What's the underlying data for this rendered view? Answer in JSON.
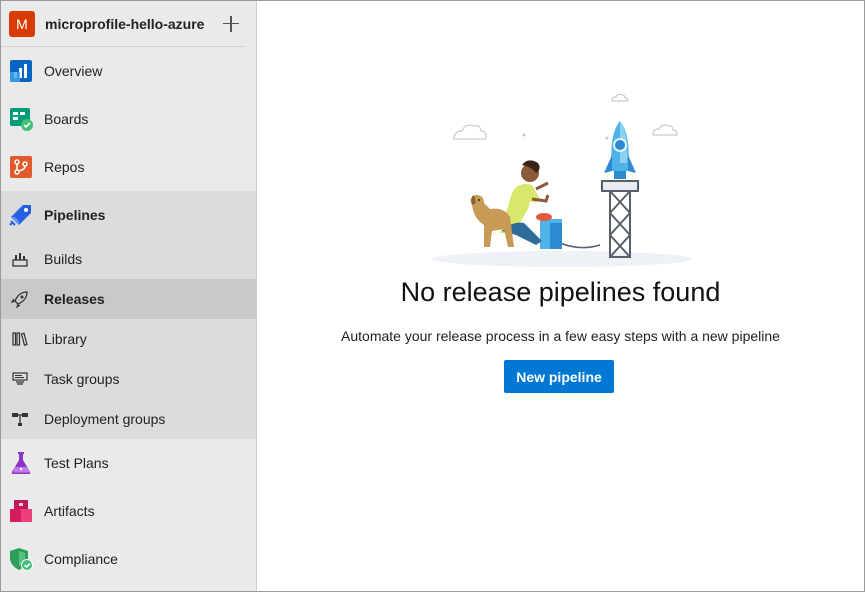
{
  "project": {
    "avatar_letter": "M",
    "name": "microprofile-hello-azure",
    "avatar_color": "#da3b01"
  },
  "nav": {
    "overview": "Overview",
    "boards": "Boards",
    "repos": "Repos",
    "pipelines": "Pipelines",
    "pipelines_sub": {
      "builds": "Builds",
      "releases": "Releases",
      "library": "Library",
      "task_groups": "Task groups",
      "deployment_groups": "Deployment groups"
    },
    "test_plans": "Test Plans",
    "artifacts": "Artifacts",
    "compliance": "Compliance"
  },
  "main": {
    "empty_title": "No release pipelines found",
    "empty_description": "Automate your release process in a few easy steps with a new pipeline",
    "new_pipeline_label": "New pipeline"
  },
  "colors": {
    "accent": "#0078d4",
    "sidebar_bg": "#eaeaea",
    "selected_bg": "#c9c9c9"
  }
}
